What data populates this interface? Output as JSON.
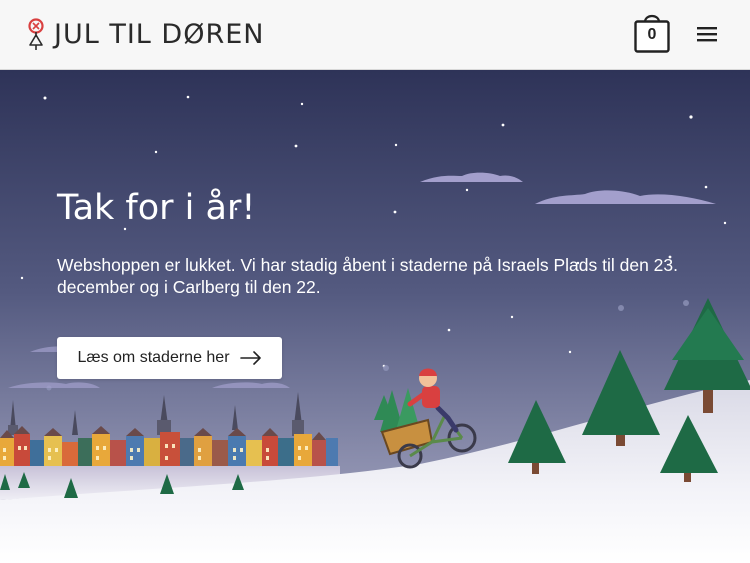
{
  "header": {
    "logo_text": "JUL TIL DØREN",
    "logo_icon": "christmas-ornament-icon",
    "cart_count": "0",
    "cart_icon": "shopping-bag-icon",
    "menu_icon": "hamburger-menu-icon"
  },
  "hero": {
    "title": "Tak for i år!",
    "text": "Webshoppen er lukket. Vi har stadig åbent i staderne på Israels Plads til den 23. december og i Carlberg til den 22.",
    "button_label": "Læs om staderne her",
    "button_icon": "arrow-right-icon"
  },
  "colors": {
    "sky_top": "#2e3358",
    "sky_bottom": "#8c8fae",
    "tree": "#1e6a45",
    "accent_red": "#d94040"
  }
}
